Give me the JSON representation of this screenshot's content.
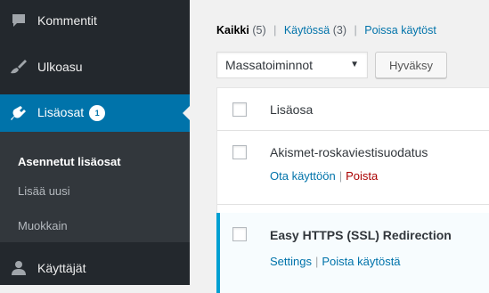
{
  "sidebar": {
    "comments_label": "Kommentit",
    "appearance_label": "Ulkoasu",
    "plugins_label": "Lisäosat",
    "plugins_badge": "1",
    "submenu": {
      "installed": "Asennetut lisäosat",
      "add_new": "Lisää uusi",
      "editor": "Muokkain"
    },
    "users_label": "Käyttäjät",
    "colors": {
      "background": "#23282d",
      "active": "#0073aa",
      "submenu": "#32373c"
    }
  },
  "filters": {
    "all_label": "Kaikki",
    "all_count": "(5)",
    "active_label": "Käytössä",
    "active_count": "(3)",
    "inactive_label": "Poissa käytöst",
    "separator": "|"
  },
  "bulk_actions": {
    "selected": "Massatoiminnot",
    "apply_label": "Hyväksy"
  },
  "table": {
    "header_label": "Lisäosa",
    "rows": [
      {
        "name": "Akismet-roskaviestisuodatus",
        "actions": [
          "Ota käyttöön",
          "Poista"
        ],
        "active": false
      },
      {
        "name": "Easy HTTPS (SSL) Redirection",
        "actions": [
          "Settings",
          "Poista käytöstä"
        ],
        "active": true
      }
    ]
  },
  "icons": {
    "comments": "speech-bubble-icon",
    "appearance": "paintbrush-icon",
    "plugins": "plug-icon",
    "users": "user-icon"
  }
}
